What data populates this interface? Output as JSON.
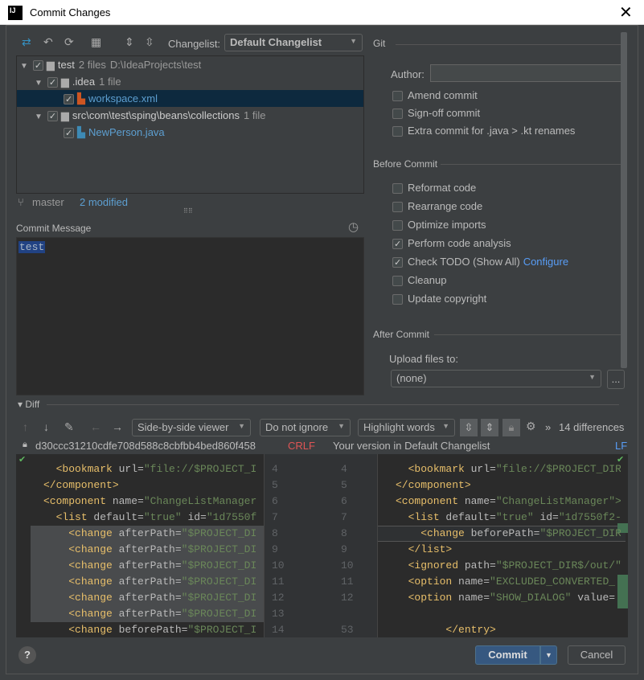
{
  "window": {
    "title": "Commit Changes",
    "close": "✕"
  },
  "toolbar": {
    "changelist_label": "Changelist:",
    "changelist_value": "Default Changelist"
  },
  "tree": [
    {
      "name": "test",
      "count": "2 files",
      "path": "D:\\IdeaProjects\\test",
      "level": 0,
      "type": "folder"
    },
    {
      "name": ".idea",
      "count": "1 file",
      "level": 1,
      "type": "folder"
    },
    {
      "name": "workspace.xml",
      "level": 2,
      "type": "xml",
      "selected": true
    },
    {
      "name": "src\\com\\test\\sping\\beans\\collections",
      "count": "1 file",
      "level": 1,
      "type": "folder"
    },
    {
      "name": "NewPerson.java",
      "level": 2,
      "type": "java"
    }
  ],
  "status": {
    "branch": "master",
    "modified": "2 modified"
  },
  "commit_message": {
    "label": "Commit Message",
    "value": "test"
  },
  "git": {
    "title": "Git",
    "author_label": "Author:",
    "author_value": "",
    "options": [
      {
        "label": "Amend commit",
        "checked": false
      },
      {
        "label": "Sign-off commit",
        "checked": false
      },
      {
        "label": "Extra commit for .java > .kt renames",
        "checked": false
      }
    ]
  },
  "before_commit": {
    "title": "Before Commit",
    "options": [
      {
        "label": "Reformat code",
        "checked": false
      },
      {
        "label": "Rearrange code",
        "checked": false
      },
      {
        "label": "Optimize imports",
        "checked": false
      },
      {
        "label": "Perform code analysis",
        "checked": true
      },
      {
        "label": "Check TODO (Show All)",
        "checked": true,
        "link": "Configure"
      },
      {
        "label": "Cleanup",
        "checked": false
      },
      {
        "label": "Update copyright",
        "checked": false
      }
    ]
  },
  "after_commit": {
    "title": "After Commit",
    "upload_label": "Upload files to:",
    "upload_value": "(none)",
    "browse": "..."
  },
  "diff": {
    "title": "Diff",
    "viewer": "Side-by-side viewer",
    "ignore": "Do not ignore",
    "highlight": "Highlight words",
    "differences": "14 differences",
    "left_rev": "d30ccc31210cdfe708d588c8cbfbb4bed860f458",
    "left_sep": "CRLF",
    "right_title": "Your version in Default Changelist",
    "right_sep": "LF",
    "left_lines": [
      {
        "n": "4",
        "indent": "  ",
        "tag": "<bookmark",
        "attr": " url=",
        "val": "\"file://$PROJECT_I"
      },
      {
        "n": "5",
        "indent": "",
        "tag": "</component>",
        "attr": "",
        "val": ""
      },
      {
        "n": "6",
        "indent": "",
        "tag": "<component",
        "attr": " name=",
        "val": "\"ChangeListManager"
      },
      {
        "n": "7",
        "indent": "  ",
        "tag": "<list",
        "attr": " default=",
        "val": "\"true\"",
        "extra": " id=",
        "val2": "\"1d7550f"
      },
      {
        "n": "8",
        "indent": "    ",
        "tag": "<change",
        "attr": " afterPath=",
        "val": "\"$PROJECT_DI"
      },
      {
        "n": "9",
        "indent": "    ",
        "tag": "<change",
        "attr": " afterPath=",
        "val": "\"$PROJECT_DI"
      },
      {
        "n": "10",
        "indent": "    ",
        "tag": "<change",
        "attr": " afterPath=",
        "val": "\"$PROJECT_DI"
      },
      {
        "n": "11",
        "indent": "    ",
        "tag": "<change",
        "attr": " afterPath=",
        "val": "\"$PROJECT_DI"
      },
      {
        "n": "12",
        "indent": "    ",
        "tag": "<change",
        "attr": " afterPath=",
        "val": "\"$PROJECT_DI"
      },
      {
        "n": "13",
        "indent": "    ",
        "tag": "<change",
        "attr": " afterPath=",
        "val": "\"$PROJECT_DI"
      },
      {
        "n": "14",
        "indent": "    ",
        "tag": "<change",
        "attr": " beforePath=",
        "val": "\"$PROJECT_I"
      }
    ],
    "right_lines": [
      {
        "n": "4",
        "indent": "  ",
        "tag": "<bookmark",
        "attr": " url=",
        "val": "\"file://$PROJECT_DIR"
      },
      {
        "n": "5",
        "indent": "",
        "tag": "</component>",
        "attr": "",
        "val": ""
      },
      {
        "n": "6",
        "indent": "",
        "tag": "<component",
        "attr": " name=",
        "val": "\"ChangeListManager\">"
      },
      {
        "n": "7",
        "indent": "  ",
        "tag": "<list",
        "attr": " default=",
        "val": "\"true\"",
        "extra": " id=",
        "val2": "\"1d7550f2-"
      },
      {
        "n": "8",
        "indent": "    ",
        "tag": "<change",
        "attr": " beforePath=",
        "val": "\"$PROJECT_DIR"
      },
      {
        "n": "9",
        "indent": "  ",
        "tag": "</list>",
        "attr": "",
        "val": ""
      },
      {
        "n": "10",
        "indent": "  ",
        "tag": "<ignored",
        "attr": " path=",
        "val": "\"$PROJECT_DIR$/out/\""
      },
      {
        "n": "11",
        "indent": "  ",
        "tag": "<option",
        "attr": " name=",
        "val": "\"EXCLUDED_CONVERTED_"
      },
      {
        "n": "12",
        "indent": "  ",
        "tag": "<option",
        "attr": " name=",
        "val": "\"SHOW_DIALOG\"",
        "extra": " value="
      },
      {
        "n": "",
        "indent": "",
        "tag": "",
        "attr": "",
        "val": ""
      },
      {
        "n": "53",
        "indent": "        ",
        "tag": "</entry>",
        "attr": "",
        "val": ""
      }
    ]
  },
  "footer": {
    "help": "?",
    "commit": "Commit",
    "cancel": "Cancel"
  },
  "colors": {
    "accent": "#365880",
    "selection": "#0d293e",
    "link": "#589df6",
    "crlf": "#e05555"
  }
}
